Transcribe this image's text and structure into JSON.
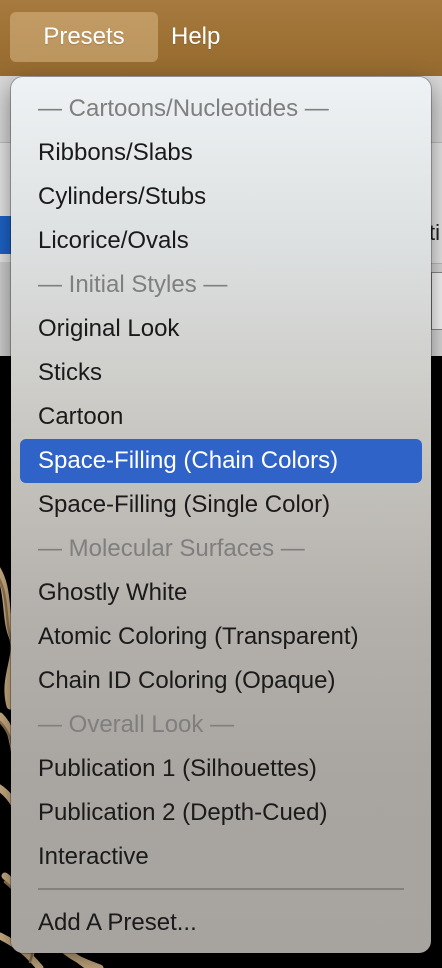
{
  "menubar": {
    "presets_label": "Presets",
    "help_label": "Help"
  },
  "background": {
    "tab_right_fragment": "ti",
    "tab_left_fragment": "r"
  },
  "menu": {
    "items": [
      {
        "label": "— Cartoons/Nucleotides —",
        "type": "header"
      },
      {
        "label": "Ribbons/Slabs",
        "type": "item"
      },
      {
        "label": "Cylinders/Stubs",
        "type": "item"
      },
      {
        "label": "Licorice/Ovals",
        "type": "item"
      },
      {
        "label": "— Initial Styles —",
        "type": "header"
      },
      {
        "label": "Original Look",
        "type": "item"
      },
      {
        "label": "Sticks",
        "type": "item"
      },
      {
        "label": "Cartoon",
        "type": "item"
      },
      {
        "label": "Space-Filling (Chain Colors)",
        "type": "item",
        "selected": true
      },
      {
        "label": "Space-Filling (Single Color)",
        "type": "item"
      },
      {
        "label": "— Molecular Surfaces —",
        "type": "header"
      },
      {
        "label": "Ghostly White",
        "type": "item"
      },
      {
        "label": "Atomic Coloring (Transparent)",
        "type": "item"
      },
      {
        "label": "Chain ID Coloring (Opaque)",
        "type": "item"
      },
      {
        "label": "— Overall Look —",
        "type": "header"
      },
      {
        "label": "Publication 1 (Silhouettes)",
        "type": "item"
      },
      {
        "label": "Publication 2 (Depth-Cued)",
        "type": "item"
      },
      {
        "label": "Interactive",
        "type": "item"
      }
    ],
    "add_preset_label": "Add A Preset..."
  },
  "colors": {
    "menubar": "#9c7033",
    "selection": "#2f63c7",
    "header_text": "#7f7f7f",
    "molecule": "#c9ad82"
  }
}
